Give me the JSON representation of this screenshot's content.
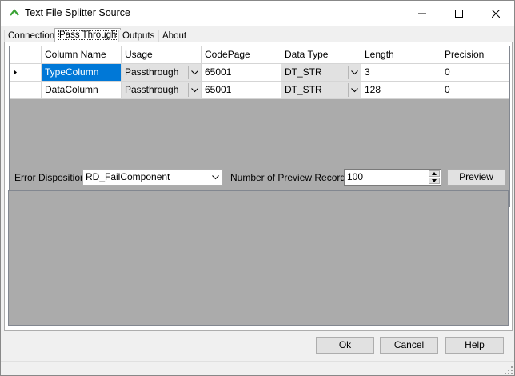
{
  "window": {
    "title": "Text File Splitter Source"
  },
  "tabs": [
    {
      "label": "Connection"
    },
    {
      "label": "Pass Through"
    },
    {
      "label": "Outputs"
    },
    {
      "label": "About"
    }
  ],
  "grid": {
    "columns": [
      "Column Name",
      "Usage",
      "CodePage",
      "Data Type",
      "Length",
      "Precision"
    ],
    "rows": [
      {
        "name": "TypeColumn",
        "usage": "Passthrough",
        "codepage": "65001",
        "datatype": "DT_STR",
        "length": "3",
        "precision": "0"
      },
      {
        "name": "DataColumn",
        "usage": "Passthrough",
        "codepage": "65001",
        "datatype": "DT_STR",
        "length": "128",
        "precision": "0"
      }
    ],
    "selected_row": 0
  },
  "error_disposition": {
    "label": "Error Disposition",
    "value": "RD_FailComponent"
  },
  "preview_records": {
    "label": "Number of Preview Records",
    "value": "100"
  },
  "preview_button": "Preview",
  "buttons": {
    "ok": "Ok",
    "cancel": "Cancel",
    "help": "Help"
  },
  "colors": {
    "selection": "#0078d7",
    "grid_background": "#ababab",
    "window_background": "#f0f0f0"
  },
  "icons": {
    "app": "green-chevron-icon",
    "minimize": "minimize-icon",
    "maximize": "maximize-icon",
    "close": "close-icon"
  }
}
